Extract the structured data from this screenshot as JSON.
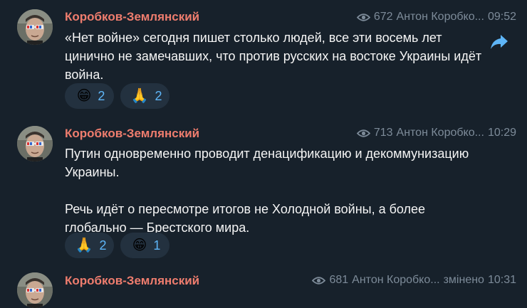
{
  "messages": [
    {
      "author": "Коробков-Землянский",
      "views": "672",
      "signature": "Антон Коробко...",
      "time": "09:52",
      "text": "«Нет войне» сегодня пишет столько людей, все эти восемь лет цинично не замечавших, что против русских на востоке Украины идёт война.",
      "reactions": [
        {
          "emoji": "😁",
          "count": "2"
        },
        {
          "emoji": "🙏",
          "count": "2"
        }
      ]
    },
    {
      "author": "Коробков-Землянский",
      "views": "713",
      "signature": "Антон Коробко...",
      "time": "10:29",
      "text": "Путин одновременно проводит денацификацию и декоммунизацию Украины.\n\nРечь идёт о пересмотре итогов не Холодной войны, а более глобально — Брестского мира.",
      "reactions": [
        {
          "emoji": "🙏",
          "count": "2"
        },
        {
          "emoji": "😁",
          "count": "1"
        }
      ]
    },
    {
      "author": "Коробков-Землянский",
      "views": "681",
      "signature": "Антон Коробко...",
      "edited": "змінено",
      "time": "10:31"
    }
  ],
  "icons": {
    "views": "eye-icon",
    "share": "share-arrow-icon"
  },
  "colors": {
    "background": "#17212b",
    "author": "#ef7d6e",
    "meta": "#7d8b99",
    "reaction_bg": "#23313f",
    "reaction_count": "#5eb5f7",
    "share": "#5eb5f7"
  }
}
